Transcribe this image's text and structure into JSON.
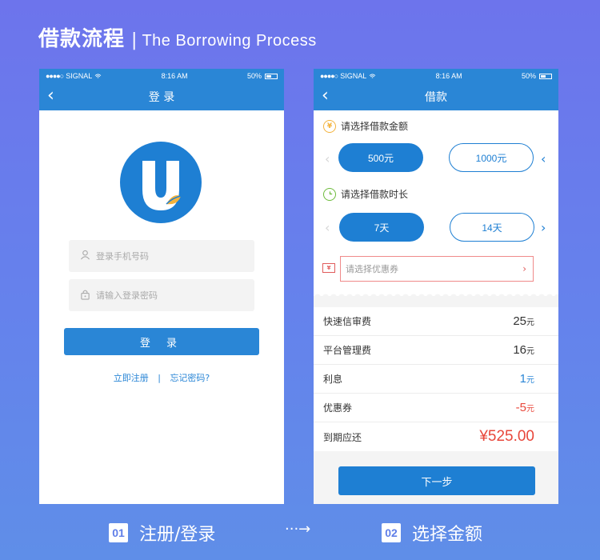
{
  "header": {
    "title_cn": "借款流程",
    "separator": "|",
    "title_en": "The Borrowing Process"
  },
  "status_bar": {
    "carrier": "SIGNAL",
    "time": "8:16 AM",
    "battery": "50%"
  },
  "login": {
    "nav_title": "登 录",
    "phone_placeholder": "登录手机号码",
    "password_placeholder": "请输入登录密码",
    "login_button": "登 录",
    "register_link": "立即注册",
    "link_separator": "|",
    "forgot_link": "忘记密码?"
  },
  "borrow": {
    "nav_title": "借款",
    "amount_title": "请选择借款金额",
    "amount_icon": "¥",
    "amount_options": [
      "500元",
      "1000元"
    ],
    "duration_title": "请选择借款时长",
    "duration_options": [
      "7天",
      "14天"
    ],
    "coupon_placeholder": "请选择优惠券",
    "coupon_arrow": "›",
    "fees": [
      {
        "label": "快速信审费",
        "value": "25",
        "unit": "元",
        "color": "#333333"
      },
      {
        "label": "平台管理费",
        "value": "16",
        "unit": "元",
        "color": "#333333"
      },
      {
        "label": "利息",
        "value": "1",
        "unit": "元",
        "color": "#2a86d6"
      },
      {
        "label": "优惠券",
        "value": "-5",
        "unit": "元",
        "color": "#e8473b"
      },
      {
        "label": "到期应还",
        "value": "¥525.00",
        "unit": "",
        "color": "#e8473b"
      }
    ],
    "next_button": "下一步"
  },
  "footer": {
    "step1_num": "01",
    "step1_label": "注册/登录",
    "arrow": "···→",
    "step2_num": "02",
    "step2_label": "选择金额"
  },
  "colors": {
    "primary": "#2a86d6",
    "accent_red": "#e8473b",
    "bg_start": "#6d74ec",
    "bg_end": "#5f8ee8"
  },
  "icons": [
    "back-arrow-icon",
    "user-icon",
    "lock-icon",
    "yen-icon",
    "clock-icon",
    "coupon-icon",
    "chevron-left-icon",
    "chevron-right-icon",
    "wifi-icon",
    "battery-icon"
  ]
}
